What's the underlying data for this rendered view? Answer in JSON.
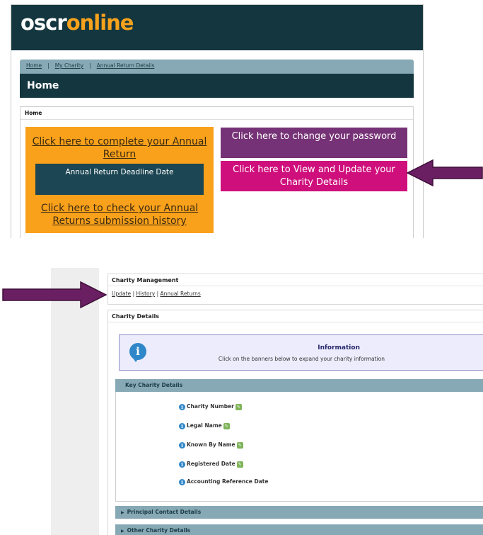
{
  "site": {
    "logo_part1": "oscr",
    "logo_o": "o",
    "logo_part2": "nline"
  },
  "breadcrumb": {
    "home": "Home",
    "my_charity": "My Charity",
    "annual_return_details": "Annual Return Details",
    "sep": "|"
  },
  "page_title": "Home",
  "home_box": {
    "title": "Home",
    "complete_link": "Click here to complete your Annual Return",
    "deadline_label": "Annual Return Deadline Date",
    "history_link": "Click here to check your Annual Returns submission history",
    "change_password": "Click here to change your password",
    "view_update": "Click here to View and Update your Charity Details"
  },
  "charity_management": {
    "title": "Charity Management",
    "links": {
      "update": "Update",
      "history": "History",
      "annual_returns": "Annual Returns",
      "sep": "|"
    }
  },
  "charity_details": {
    "title": "Charity Details",
    "info": {
      "title": "Information",
      "subtitle": "Click on the banners below to expand your charity information"
    },
    "key_details": {
      "header": "Key Charity Details",
      "fields": [
        "Charity Number",
        "Legal Name",
        "Known By Name",
        "Registered Date",
        "Accounting Reference Date"
      ]
    },
    "collapsed": [
      "Principal Contact Details",
      "Other Charity Details"
    ]
  },
  "colors": {
    "header_dark": "#14363f",
    "accent_orange": "#f9a11b",
    "purple": "#763276",
    "magenta": "#cf0f7c",
    "banner_blue": "#86a9b5",
    "arrow_purple": "#6b1f63"
  },
  "icons": [
    "info-icon",
    "edit-icon",
    "arrow-icon",
    "expand-triangle-icon"
  ]
}
